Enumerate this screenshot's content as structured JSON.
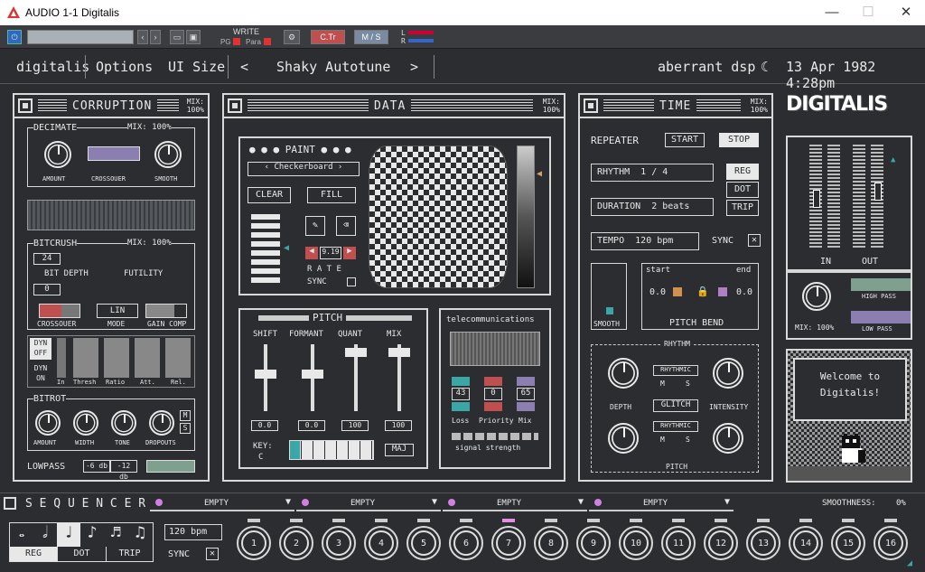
{
  "window": {
    "title": "AUDIO 1-1 Digitalis"
  },
  "host": {
    "write": "WRITE",
    "pg": "PG",
    "para": "Para",
    "ctr": "C.Tr",
    "ms": "M / S",
    "l": "L",
    "r": "R"
  },
  "toolbar": {
    "brand": "digitalis",
    "options": "Options",
    "ui_size": "UI Size",
    "preset": "Shaky Autotune",
    "vendor": "aberrant dsp",
    "date": "13 Apr 1982 4:28pm"
  },
  "corruption": {
    "title": "CORRUPTION",
    "mix": "MIX:",
    "mix_val": "100%",
    "decimate": "DECIMATE",
    "decimate_mix": "MIX: 100%",
    "amount": "AMOUNT",
    "crossover": "CROSSOUER",
    "smooth": "SMOOTH",
    "bitcrush": "BITCRUSH",
    "bitcrush_mix": "MIX: 100%",
    "bit_depth_val": "24",
    "bit_depth": "BIT DEPTH",
    "futility": "FUTILITY",
    "futility_val": "0",
    "crossover2": "CROSSOUER",
    "mode": "MODE",
    "mode_val": "LIN",
    "gain_comp": "GAIN COMP",
    "dyn_off": "DYN OFF",
    "dyn_on": "DYN ON",
    "dyn_labels": [
      "In",
      "Thresh",
      "Ratio",
      "Att.",
      "Rel."
    ],
    "bitrot": "BITROT",
    "bitrot_knobs": [
      "AMOUNT",
      "WIDTH",
      "TONE",
      "DROPOUTS"
    ],
    "m": "M",
    "s": "S",
    "lowpass": "LOWPASS",
    "lp1": "-6 db",
    "lp2": "-12 db"
  },
  "data": {
    "title": "DATA",
    "mix": "MIX:",
    "mix_val": "100%",
    "paint": "PAINT",
    "pattern": "Checkerboard",
    "clear": "CLEAR",
    "fill": "FILL",
    "rate_val": "9.19",
    "rate": "R A T E",
    "sync": "SYNC"
  },
  "pitch": {
    "title": "PITCH",
    "sliders": [
      "SHIFT",
      "FORMANT",
      "QUANT",
      "MIX"
    ],
    "values": [
      "0.0",
      "0.0",
      "100",
      "100"
    ],
    "key": "KEY:",
    "key_val": "C",
    "scale": "MAJ"
  },
  "telecom": {
    "title": "telecommunications",
    "values": [
      "43",
      "0",
      "65"
    ],
    "labels": [
      "Loss",
      "Priority",
      "Mix"
    ],
    "signal": "signal strength"
  },
  "time": {
    "title": "TIME",
    "mix": "MIX:",
    "mix_val": "100%",
    "repeater": "REPEATER",
    "start": "START",
    "stop": "STOP",
    "rhythm": "RHYTHM",
    "rhythm_val": "1  /  4",
    "duration": "DURATION",
    "duration_val": "2 beats",
    "tempo": "TEMPO",
    "tempo_val": "120 bpm",
    "sync": "SYNC",
    "reg": "REG",
    "dot": "DOT",
    "trip": "TRIP",
    "smooth": "SMOOTH",
    "start_lbl": "start",
    "end_lbl": "end",
    "start_val": "0.0",
    "end_val": "0.0",
    "pitch_bend": "PITCH BEND",
    "g_rhythm": "RHYTHM",
    "rhythmic": "RHYTHMIC",
    "depth": "DEPTH",
    "glitch": "GLITCH",
    "intensity": "INTENSITY",
    "rhythmic2": "RHYTHMIC",
    "g_pitch": "PITCH",
    "m": "M",
    "s": "S"
  },
  "right": {
    "logo": "DIGITALIS",
    "in": "IN",
    "out": "OUT",
    "mix": "MIX: 100%",
    "hp": "HIGH PASS",
    "lp": "LOW PASS",
    "welcome": "Welcome to Digitalis!"
  },
  "sequencer": {
    "title": "S E Q U E N C E R",
    "slots": [
      "EMPTY",
      "EMPTY",
      "EMPTY",
      "EMPTY"
    ],
    "smoothness": "SMOOTHNESS:",
    "smooth_val": "0%",
    "reg": "REG",
    "dot": "DOT",
    "trip": "TRIP",
    "bpm": "120 bpm",
    "sync": "SYNC",
    "steps": [
      "1",
      "2",
      "3",
      "4",
      "5",
      "6",
      "7",
      "8",
      "9",
      "10",
      "11",
      "12",
      "13",
      "14",
      "15",
      "16"
    ]
  },
  "colors": {
    "bg": "#2b2d30",
    "fg": "#e8e8e8",
    "accent_purple": "#8a7fb0",
    "accent_green": "#7fa08f",
    "accent_red": "#c05050",
    "accent_teal": "#3aa6a6"
  }
}
